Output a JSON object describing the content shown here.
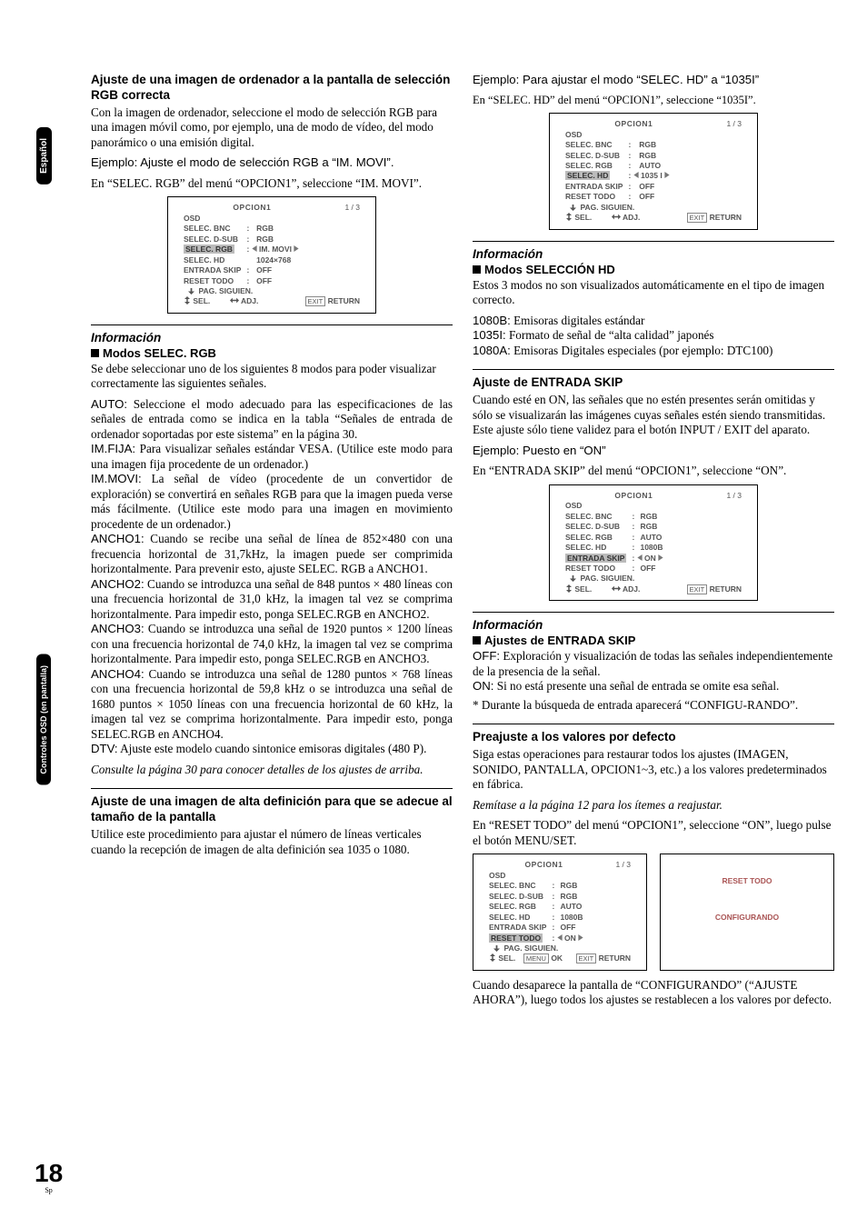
{
  "page": {
    "num": "18",
    "lang": "Sp"
  },
  "sidetabs": {
    "t1": "Español",
    "t2": "Controles OSD (en pantalla)"
  },
  "left": {
    "h1": "Ajuste de una imagen de ordenador a la pantalla de selección RGB correcta",
    "p1": "Con la imagen de ordenador, seleccione el modo de selección RGB para una imagen móvil como, por ejemplo, una de modo de vídeo, del modo panorámico o una emisión digital.",
    "p2": "Ejemplo: Ajuste el modo de selección RGB a “IM. MOVI”.",
    "p3": "En “SELEC. RGB” del menú “OPCION1”, seleccione “IM. MOVI”.",
    "osd1": {
      "title": "OPCION1",
      "ratio": "1 / 3",
      "rows": [
        [
          "OSD",
          "",
          ""
        ],
        [
          "SELEC. BNC",
          ":",
          "RGB"
        ],
        [
          "SELEC. D-SUB",
          ":",
          "RGB"
        ],
        [
          "SELEC. RGB",
          ": ◀ IM. MOVI ▶",
          ""
        ],
        [
          "SELEC. HD",
          "",
          "1024×768"
        ],
        [
          "ENTRADA SKIP",
          ":",
          "OFF"
        ],
        [
          "RESET TODO",
          ":",
          "OFF"
        ],
        [
          "↓  PAG. SIGUIEN.",
          "",
          ""
        ]
      ],
      "foot": {
        "sel": "SEL.",
        "adj": "ADJ.",
        "exit": "EXIT",
        "ret": "RETURN"
      },
      "hlrow": 3
    },
    "info1": {
      "title": "Información",
      "sub": "Modos SELEC. RGB",
      "lead": "Se debe seleccionar uno de los siguientes 8 modos para poder visualizar correctamente las siguientes señales.",
      "items": [
        {
          "k": "AUTO:",
          "t": " Seleccione el modo adecuado para las especificaciones de las señales de entrada como se indica en la tabla “Señales de entrada de ordenador soportadas por este sistema” en la página 30."
        },
        {
          "k": "IM.FIJA:",
          "t": " Para visualizar señales estándar VESA. (Utilice este modo para una imagen fija procedente de un ordenador.)"
        },
        {
          "k": "IM.MOVI:",
          "t": " La señal de vídeo (procedente de un convertidor de exploración) se convertirá en señales RGB para que la imagen pueda verse más fácilmente. (Utilice este modo para una imagen en movimiento procedente de un ordenador.)"
        },
        {
          "k": "ANCHO1:",
          "t": " Cuando se recibe una señal de línea de 852×480 con una frecuencia horizontal de 31,7kHz, la imagen puede ser comprimida horizontalmente. Para prevenir esto, ajuste SELEC. RGB a ANCHO1."
        },
        {
          "k": "ANCHO2:",
          "t": " Cuando se introduzca una señal de 848 puntos × 480 líneas con una frecuencia horizontal de 31,0 kHz, la imagen tal vez se comprima horizontalmente. Para impedir esto, ponga SELEC.RGB en ANCHO2."
        },
        {
          "k": "ANCHO3:",
          "t": " Cuando se introduzca una señal de 1920 puntos × 1200 líneas con una frecuencia horizontal de 74,0 kHz, la imagen tal vez se comprima horizontalmente. Para impedir esto, ponga SELEC.RGB en ANCHO3."
        },
        {
          "k": "ANCHO4:",
          "t": " Cuando se introduzca una señal de 1280 puntos × 768 líneas con una frecuencia horizontal de 59,8 kHz o se introduzca una señal de 1680 puntos × 1050 líneas con una frecuencia horizontal de 60 kHz, la imagen tal vez se comprima horizontalmente. Para impedir esto, ponga SELEC.RGB en ANCHO4."
        },
        {
          "k": "DTV:",
          "t": " Ajuste este modelo cuando sintonice emisoras digitales (480 P)."
        }
      ],
      "trailer": "Consulte la página 30 para conocer detalles de los ajustes de arriba."
    },
    "h2": "Ajuste de una imagen de alta definición para que se adecue al tamaño de la pantalla",
    "p4": "Utilice este procedimiento para ajustar el número de líneas verticales cuando la recepción de imagen de alta definición sea 1035 o 1080."
  },
  "right": {
    "p1": "Ejemplo: Para ajustar el modo “SELEC. HD” a “1035I”",
    "p2": "En “SELEC. HD” del menú “OPCION1”, seleccione “1035I”.",
    "osd2": {
      "title": "OPCION1",
      "ratio": "1 / 3",
      "rows": [
        [
          "OSD",
          "",
          ""
        ],
        [
          "SELEC. BNC",
          ":",
          "RGB"
        ],
        [
          "SELEC. D-SUB",
          ":",
          "RGB"
        ],
        [
          "SELEC. RGB",
          ":",
          "AUTO"
        ],
        [
          "SELEC. HD",
          ": ◀ 1035 I ▶",
          ""
        ],
        [
          "ENTRADA SKIP",
          ":",
          "OFF"
        ],
        [
          "RESET TODO",
          ":",
          "OFF"
        ],
        [
          "↓  PAG. SIGUIEN.",
          "",
          ""
        ]
      ],
      "foot": {
        "sel": "SEL.",
        "adj": "ADJ.",
        "exit": "EXIT",
        "ret": "RETURN"
      },
      "hlrow": 4
    },
    "info2": {
      "title": "Información",
      "sub": "Modos SELECCIÓN HD",
      "lead": "Estos 3 modos no son visualizados automáticamente en el tipo de imagen correcto.",
      "items": [
        {
          "k": "1080B:",
          "t": " Emisoras digitales estándar"
        },
        {
          "k": "1035I:",
          "t": " Formato de señal de “alta calidad” japonés"
        },
        {
          "k": "1080A:",
          "t": " Emisoras Digitales especiales (por ejemplo: DTC100)"
        }
      ]
    },
    "h2": "Ajuste de ENTRADA SKIP",
    "p3": "Cuando esté en ON, las señales que no estén presentes serán omitidas y sólo se visualizarán las imágenes cuyas señales estén siendo transmitidas.",
    "p4": "Este ajuste sólo tiene validez para el botón INPUT / EXIT del aparato.",
    "p5": "Ejemplo: Puesto en “ON”",
    "p6": "En “ENTRADA SKIP” del menú “OPCION1”, seleccione “ON”.",
    "osd3": {
      "title": "OPCION1",
      "ratio": "1 / 3",
      "rows": [
        [
          "OSD",
          "",
          ""
        ],
        [
          "SELEC. BNC",
          ":",
          "RGB"
        ],
        [
          "SELEC. D-SUB",
          ":",
          "RGB"
        ],
        [
          "SELEC. RGB",
          ":",
          "AUTO"
        ],
        [
          "SELEC. HD",
          ":",
          "1080B"
        ],
        [
          "ENTRADA SKIP",
          ": ◀ ON ▶",
          ""
        ],
        [
          "RESET TODO",
          ":",
          "OFF"
        ],
        [
          "↓  PAG. SIGUIEN.",
          "",
          ""
        ]
      ],
      "foot": {
        "sel": "SEL.",
        "adj": "ADJ.",
        "exit": "EXIT",
        "ret": "RETURN"
      },
      "hlrow": 5
    },
    "info3": {
      "title": "Información",
      "sub": "Ajustes de ENTRADA SKIP",
      "items": [
        {
          "k": "OFF:",
          "t": " Exploración y visualización de todas las señales independientemente de la presencia de la señal."
        },
        {
          "k": "ON:",
          "t": " Si no está presente una señal de entrada se omite esa señal."
        }
      ],
      "note": "* Durante la búsqueda de entrada aparecerá “CONFIGU-RANDO”."
    },
    "h3": "Preajuste a los valores por defecto",
    "p7": "Siga estas operaciones para restaurar todos los ajustes (IMAGEN, SONIDO, PANTALLA, OPCION1~3, etc.) a los valores predeterminados en fábrica.",
    "p8": "Remítase a la página 12 para los ítemes a reajustar.",
    "p9": "En “RESET TODO” del menú “OPCION1”, seleccione “ON”, luego pulse el botón MENU/SET.",
    "osd4left": {
      "title": "OPCION1",
      "ratio": "1 / 3",
      "rows": [
        [
          "OSD",
          "",
          ""
        ],
        [
          "SELEC. BNC",
          ":",
          "RGB"
        ],
        [
          "SELEC. D-SUB",
          ":",
          "RGB"
        ],
        [
          "SELEC. RGB",
          ":",
          "AUTO"
        ],
        [
          "SELEC. HD",
          ":",
          "1080B"
        ],
        [
          "ENTRADA SKIP",
          ":",
          "OFF"
        ],
        [
          "RESET TODO",
          ": ◀ ON ▶",
          ""
        ],
        [
          "↓  PAG. SIGUIEN.",
          "",
          ""
        ]
      ],
      "foot": {
        "sel": "SEL.",
        "menu": "MENU",
        "ok": "OK",
        "exit": "EXIT",
        "ret": "RETURN"
      },
      "hlrow": 6
    },
    "osd4right": {
      "l1": "RESET TODO",
      "l2": "CONFIGURANDO"
    },
    "p10": "Cuando desaparece la pantalla de “CONFIGURANDO” (“AJUSTE AHORA”), luego todos los ajustes se restablecen a los valores por defecto."
  }
}
